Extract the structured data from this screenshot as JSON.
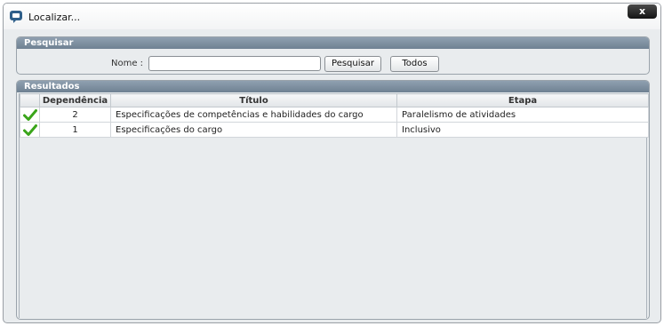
{
  "window": {
    "title": "Localizar...",
    "close_label": "x",
    "app_icon": "chat-bubble-icon"
  },
  "search": {
    "header": "Pesquisar",
    "name_label": "Nome :",
    "name_value": "",
    "name_placeholder": "",
    "search_button": "Pesquisar",
    "all_button": "Todos"
  },
  "results": {
    "header": "Resultados",
    "columns": [
      "",
      "Dependência",
      "Título",
      "Etapa"
    ],
    "rows": [
      {
        "status_icon": "checkmark-icon",
        "dependencia": "2",
        "titulo": "Especificações de competências e habilidades do cargo",
        "etapa": "Paralelismo de atividades"
      },
      {
        "status_icon": "checkmark-icon",
        "dependencia": "1",
        "titulo": "Especificações do cargo",
        "etapa": "Inclusivo"
      }
    ]
  },
  "colors": {
    "panel_header": "#7a8b9c",
    "close_button": "#1f1f1f",
    "check": "#3aa51a"
  }
}
